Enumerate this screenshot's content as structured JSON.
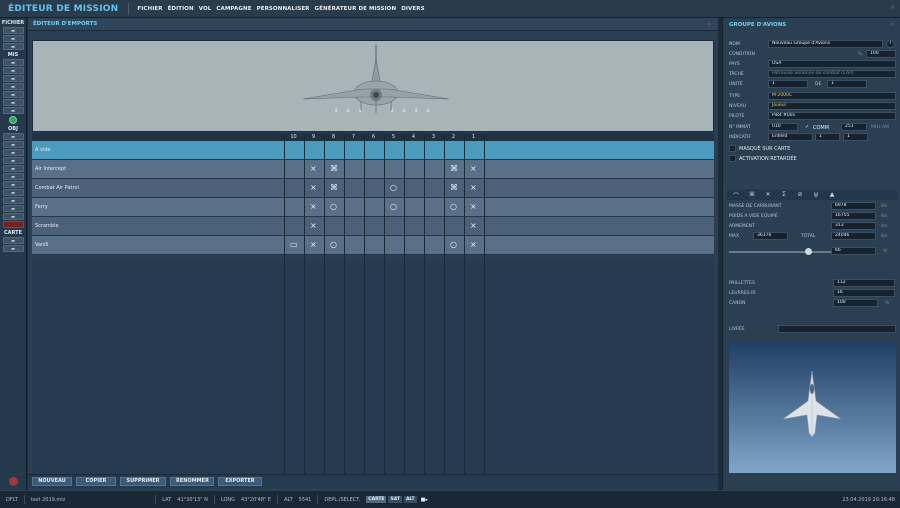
{
  "app": {
    "title": "ÉDITEUR DE MISSION",
    "menu": [
      "FICHIER",
      "ÉDITION",
      "VOL",
      "CAMPAGNE",
      "PERSONNALISER",
      "GÉNÉRATEUR DE MISSION",
      "DIVERS"
    ],
    "close": "×"
  },
  "toolbar": {
    "sections": [
      "FICHIER",
      "MIS",
      "OBJ",
      "CARTE"
    ]
  },
  "loadout": {
    "title": "ÉDITEUR D'EMPORTS",
    "close": "×",
    "stations": [
      "10",
      "9",
      "8",
      "7",
      "6",
      "5",
      "4",
      "3",
      "2",
      "1"
    ],
    "rows": [
      {
        "label": "A vide",
        "marks": [
          "",
          "",
          "",
          "",
          "",
          "",
          "",
          "",
          "",
          ""
        ]
      },
      {
        "label": "Air Intercept",
        "marks": [
          "",
          "×",
          "⌘",
          "",
          "",
          "",
          "",
          "",
          "⌘",
          "×"
        ]
      },
      {
        "label": "Combat Air Patrol",
        "marks": [
          "",
          "×",
          "⌘",
          "",
          "",
          "○",
          "",
          "",
          "⌘",
          "×"
        ]
      },
      {
        "label": "Ferry",
        "marks": [
          "",
          "×",
          "○",
          "",
          "",
          "○",
          "",
          "",
          "○",
          "×"
        ]
      },
      {
        "label": "Scramble",
        "marks": [
          "",
          "×",
          "",
          "",
          "",
          "",
          "",
          "",
          "",
          "×"
        ]
      },
      {
        "label": "Vanill",
        "marks": [
          "▭",
          "×",
          "○",
          "",
          "",
          "",
          "",
          "",
          "○",
          "×"
        ]
      }
    ],
    "buttons": [
      "NOUVEAU",
      "COPIER",
      "SUPPRIMER",
      "RENOMMER",
      "EXPORTER"
    ]
  },
  "group": {
    "title": "GROUPE D'AVIONS",
    "close": "×",
    "help": "?",
    "fields": {
      "nom_label": "NOM",
      "nom": "Nouveau Groupe d'Avions",
      "condition_label": "CONDITION",
      "condition": "100",
      "condition_unit": "%",
      "pays_label": "PAYS",
      "pays": "USA",
      "tache_label": "TÂCHE",
      "tache": "Patrouille aérienne de combat (CAP)",
      "unite_label": "UNITÉ",
      "unite": "1",
      "de_label": "DE",
      "de": "1",
      "type_label": "TYPE",
      "type": "M-2000C",
      "niveau_label": "NIVEAU",
      "niveau": "Joueur",
      "pilote_label": "PILOTE",
      "pilote": "Pilot #001",
      "immat_label": "N° IMMAT",
      "immat": "010",
      "comm_label": "COMM",
      "comm": "251",
      "comm_unit": "MHz AM",
      "indicatif_label": "INDICATIF",
      "indicatif": "Enfield",
      "ind1": "1",
      "ind2": "1",
      "masque": "MASQUÉ SUR CARTE",
      "activation": "ACTIVATION RETARDÉE"
    },
    "payload": {
      "carburant_label": "MASSE DE CARBURANT",
      "carburant": "6978",
      "vide_label": "POIDS A VIDE EQUIPÉ",
      "vide": "16755",
      "armement_label": "ARMEMENT",
      "armement": "313",
      "max_label": "MAX",
      "max": "36376",
      "total_label": "TOTAL",
      "total": "24046",
      "unit": "lbs",
      "fuel_pct": "66",
      "pct_unit": "%",
      "paillettes_label": "PAILLETTES",
      "paillettes": "112",
      "leurres_label": "LEURRES IR",
      "leurres": "16",
      "canon_label": "CANON",
      "canon": "100",
      "livree_label": "LIVRÉE"
    }
  },
  "status": {
    "mode": "DFLT",
    "file": "test 2019.miz",
    "lat_label": "LAT",
    "lat": "41°30'13\" N",
    "long_label": "LONG",
    "long": "43°20'48\" E",
    "alt_label": "ALT",
    "alt": "5541",
    "depl": "DEPL./SELECT.",
    "carte": "CARTE",
    "sat": "SAT",
    "alt2": "ALT",
    "time": "23.04.2019 20:16:48"
  }
}
